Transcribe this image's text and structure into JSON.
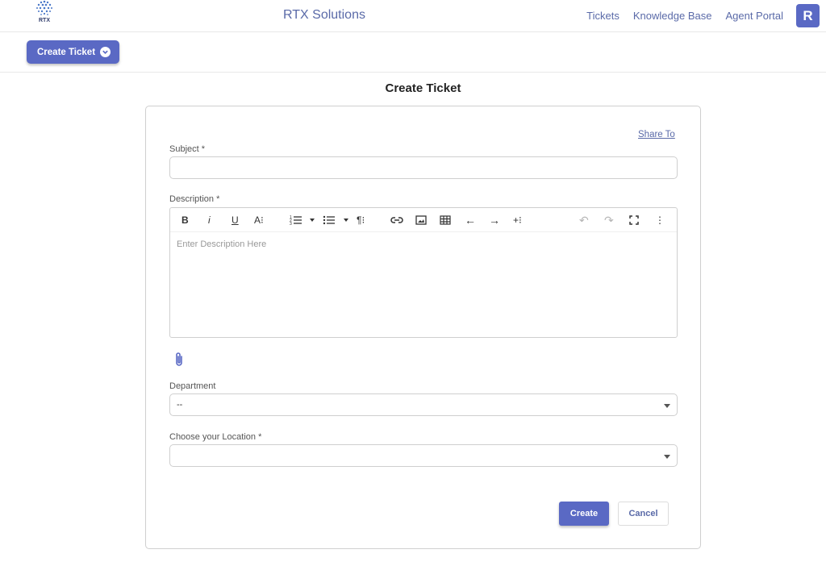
{
  "header": {
    "logo_text": "RTX",
    "brand": "RTX Solutions",
    "nav": [
      "Tickets",
      "Knowledge Base",
      "Agent Portal"
    ],
    "avatar_letter": "R"
  },
  "subbar": {
    "create_button": "Create Ticket"
  },
  "page": {
    "title": "Create Ticket"
  },
  "form": {
    "share_to": "Share To",
    "subject_label": "Subject *",
    "subject_value": "",
    "description_label": "Description *",
    "description_placeholder": "Enter Description Here",
    "toolbar": {
      "bold": "B",
      "italic": "i",
      "underline": "U",
      "font_size": "A⁝",
      "ordered_list": "☰",
      "unordered_list": "☰",
      "paragraph": "¶⁝",
      "link": "🔗",
      "image": "▣",
      "table": "⊞",
      "outdent": "←",
      "indent": "→",
      "insert": "+⁝",
      "undo": "↶",
      "redo": "↷",
      "fullscreen": "⛶",
      "more": "⋮"
    },
    "department_label": "Department",
    "department_value": "--",
    "location_label": "Choose your Location *",
    "location_value": "",
    "create_button": "Create",
    "cancel_button": "Cancel"
  },
  "colors": {
    "accent": "#5a69c4",
    "link": "#5a6aa8"
  }
}
